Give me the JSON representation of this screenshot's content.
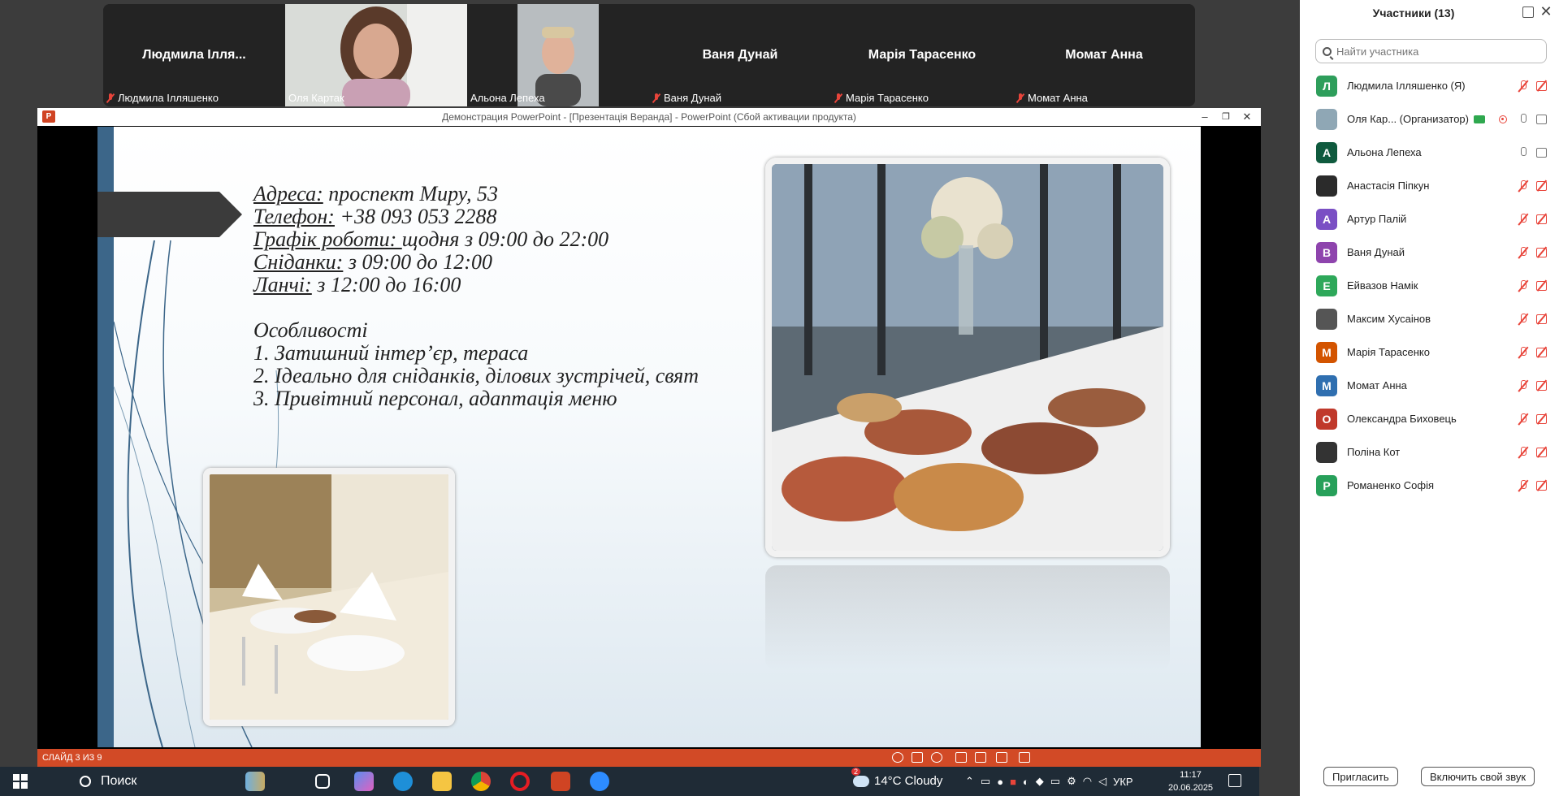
{
  "video_strip": {
    "tiles": [
      {
        "big_name": "Людмила Ілля...",
        "label": "Людмила Ілляшенко",
        "muted": true
      },
      {
        "big_name": "",
        "label": "Оля Картак",
        "muted": false
      },
      {
        "big_name": "",
        "label": "Альона Лепеха",
        "muted": false
      },
      {
        "big_name": "Ваня Дунай",
        "label": "Ваня Дунай",
        "muted": true
      },
      {
        "big_name": "Марія Тарасенко",
        "label": "Марія Тарасенко",
        "muted": true
      },
      {
        "big_name": "Момат Анна",
        "label": "Момат Анна",
        "muted": true
      }
    ]
  },
  "ppt": {
    "logo": "P",
    "window_title": "Демонстрация PowerPoint - [Презентація Веранда] - PowerPoint (Сбой активации продукта)",
    "minimize": "–",
    "restore": "❐",
    "close": "✕",
    "status_slide": "СЛАЙД 3 ИЗ 9"
  },
  "slide": {
    "lines": [
      {
        "label": "Адреса:",
        "value": " проспект Миру, 53"
      },
      {
        "label": "Телефон:",
        "value": " +38 093 053 2288"
      },
      {
        "label": "Графік роботи: ",
        "value": "щодня з 09:00 до 22:00"
      },
      {
        "label": "Сніданки:",
        "value": " з 09:00 до 12:00"
      },
      {
        "label": "Ланчі:",
        "value": " з 12:00 до 16:00"
      }
    ],
    "features_title": "Особливості",
    "features": [
      "1. Затишний інтер’єр, тераса",
      "2. Ідеально для сніданків, ділових зустрічей, свят",
      "3. Привітний персонал, адаптація меню"
    ]
  },
  "panel": {
    "title": "Участники (13)",
    "close": "✕",
    "search_placeholder": "Найти участника",
    "participants": [
      {
        "initial": "Л",
        "name": "Людмила Ілляшенко (Я)",
        "color": "#2e9e5b",
        "mic": "off",
        "video": "off"
      },
      {
        "initial": "",
        "name": "Оля Кар... (Организатор)",
        "color": "#8fa7b5",
        "mic": "on",
        "video": "on",
        "host": true
      },
      {
        "initial": "А",
        "name": "Альона Лепеха",
        "color": "#0f5a3e",
        "mic": "on",
        "video": "on"
      },
      {
        "initial": "",
        "name": "Анастасія Піпкун",
        "color": "#2b2b2b",
        "mic": "off",
        "video": "off"
      },
      {
        "initial": "А",
        "name": "Артур Палій",
        "color": "#7a4fc4",
        "mic": "off",
        "video": "off"
      },
      {
        "initial": "В",
        "name": "Ваня Дунай",
        "color": "#8e44ad",
        "mic": "off",
        "video": "off"
      },
      {
        "initial": "Е",
        "name": "Ейвазов Намік",
        "color": "#2ea85a",
        "mic": "off",
        "video": "off"
      },
      {
        "initial": "",
        "name": "Максим Хусаінов",
        "color": "#555555",
        "mic": "off",
        "video": "off"
      },
      {
        "initial": "М",
        "name": "Марія Тарасенко",
        "color": "#d35400",
        "mic": "off",
        "video": "off"
      },
      {
        "initial": "М",
        "name": "Момат Анна",
        "color": "#2f6fb0",
        "mic": "off",
        "video": "off"
      },
      {
        "initial": "О",
        "name": "Олександра Биховець",
        "color": "#c0392b",
        "mic": "off",
        "video": "off"
      },
      {
        "initial": "",
        "name": "Поліна Кот",
        "color": "#333333",
        "mic": "off",
        "video": "off"
      },
      {
        "initial": "Р",
        "name": "Романенко Софія",
        "color": "#27a05a",
        "mic": "off",
        "video": "off"
      }
    ],
    "invite_label": "Пригласить",
    "unmute_label": "Включить свой звук"
  },
  "taskbar": {
    "search_label": "Поиск",
    "weather_badge": "2",
    "weather_text": "14°C  Cloudy",
    "language": "УКР",
    "time": "11:17",
    "date": "20.06.2025"
  }
}
